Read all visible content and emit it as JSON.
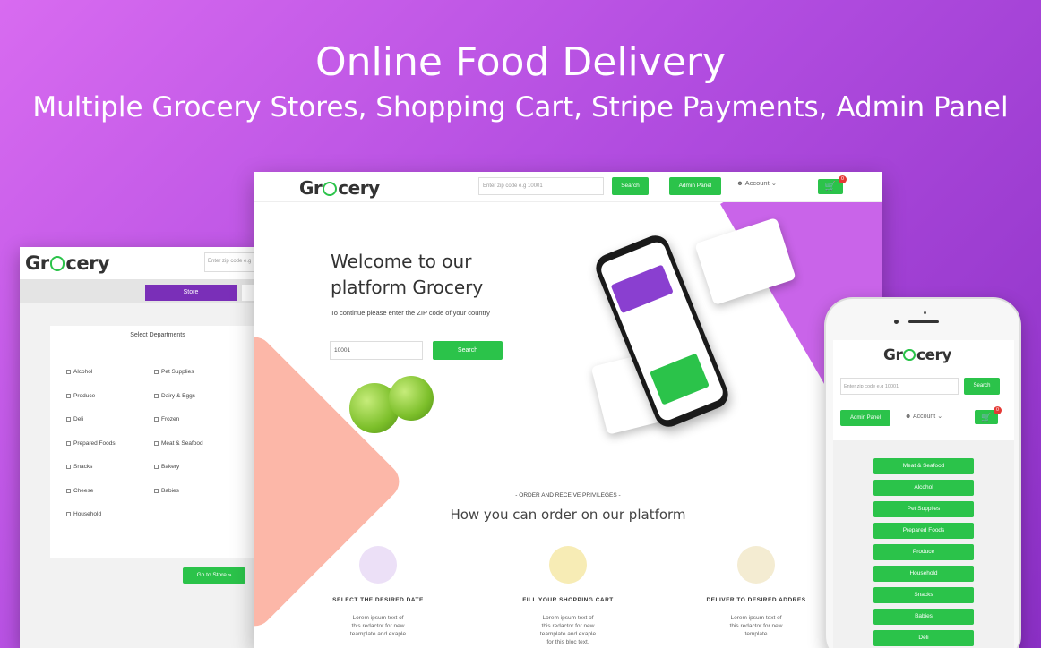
{
  "banner": {
    "title": "Online Food Delivery",
    "subtitle": "Multiple Grocery Stores, Shopping Cart,  Stripe Payments, Admin Panel"
  },
  "brand": {
    "logo_left": "Gr",
    "logo_right": "cery"
  },
  "left_screen": {
    "zip_placeholder": "Enter zip code e.g",
    "store_tab": "Store",
    "panel_title": "Select Departments",
    "departments_col1": [
      "Alcohol",
      "Produce",
      "Deli",
      "Prepared Foods",
      "Snacks",
      "Cheese",
      "Household"
    ],
    "departments_col2": [
      "Pet Supplies",
      "Dairy & Eggs",
      "Frozen",
      "Meat & Seafood",
      "Bakery",
      "Babies"
    ],
    "goto_button": "Go to Store »"
  },
  "center_screen": {
    "zip_placeholder": "Enter zip code e.g 10001",
    "search_label": "Search",
    "admin_label": "Admin Panel",
    "account_label": "Account",
    "cart_count": "0",
    "welcome_line1": "Welcome to our",
    "welcome_line2": "platform Grocery",
    "continue_text": "To continue please enter the ZIP code of your country",
    "zip_value": "10001",
    "search2_label": "Search",
    "privileges": "- ORDER AND RECEIVE PRIVILEGES -",
    "how_title": "How you can order on our platform",
    "steps": [
      {
        "title": "SELECT THE DESIRED DATE",
        "desc": "Lorem ipsum text of this redactor for new teamplate and exaple"
      },
      {
        "title": "FILL YOUR SHOPPING CART",
        "desc": "Lorem ipsum text of this redactor for new teamplate and exaple for this bloc text."
      },
      {
        "title": "DELIVER TO DESIRED ADDRES",
        "desc": "Lorem ipsum text of this redactor for new template"
      }
    ]
  },
  "right_phone": {
    "zip_placeholder": "Enter zip code e.g 10001",
    "search_label": "Search",
    "admin_label": "Admin Panel",
    "account_label": "Account",
    "cart_count": "0",
    "categories": [
      "Meat & Seafood",
      "Alcohol",
      "Pet Supplies",
      "Prepared Foods",
      "Produce",
      "Household",
      "Snacks",
      "Babies",
      "Deli"
    ]
  },
  "colors": {
    "accent": "#2bc34a",
    "purple": "#7a2fb8",
    "pink": "#fcb7a8"
  }
}
